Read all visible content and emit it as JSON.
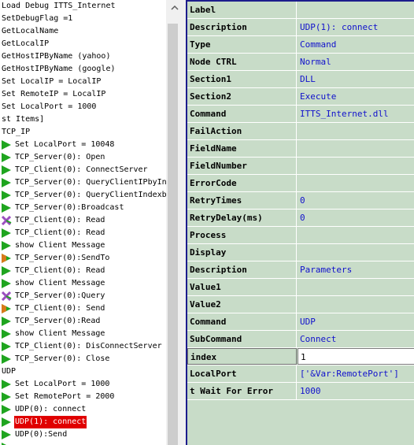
{
  "tree": {
    "items": [
      {
        "text": "Load Debug ITTS_Internet",
        "icon": ""
      },
      {
        "text": "SetDebugFlag =1",
        "icon": ""
      },
      {
        "text": "GetLocalName",
        "icon": ""
      },
      {
        "text": "GetLocalIP",
        "icon": ""
      },
      {
        "text": "GetHostIPByName (yahoo)",
        "icon": ""
      },
      {
        "text": "GetHostIPByName (google)",
        "icon": ""
      },
      {
        "text": "Set LocalIP = LocalIP",
        "icon": ""
      },
      {
        "text": "Set RemoteIP = LocalIP",
        "icon": ""
      },
      {
        "text": "Set LocalPort = 1000",
        "icon": ""
      },
      {
        "text": "st Items]",
        "icon": ""
      },
      {
        "text": "TCP_IP",
        "icon": ""
      },
      {
        "text": "Set LocalPort = 10048",
        "icon": "play"
      },
      {
        "text": "TCP_Server(0): Open",
        "icon": "play"
      },
      {
        "text": "TCP_Client(0): ConnectServer",
        "icon": "play"
      },
      {
        "text": "TCP_Server(0): QueryClientIPbyIn",
        "icon": "play"
      },
      {
        "text": "TCP_Server(0): QueryClientIndexb",
        "icon": "play"
      },
      {
        "text": "TCP_Server(0):Broadcast",
        "icon": "play"
      },
      {
        "text": "TCP_Client(0): Read",
        "icon": "x"
      },
      {
        "text": "TCP_Client(0): Read",
        "icon": "play"
      },
      {
        "text": "show Client Message",
        "icon": "play"
      },
      {
        "text": "TCP_Server(0):SendTo",
        "icon": "playorange"
      },
      {
        "text": "TCP_Client(0): Read",
        "icon": "play"
      },
      {
        "text": "show Client Message",
        "icon": "play"
      },
      {
        "text": "TCP_Server(0):Query",
        "icon": "x"
      },
      {
        "text": "TCP_Client(0): Send",
        "icon": "playorange"
      },
      {
        "text": "TCP_Server(0):Read",
        "icon": "play"
      },
      {
        "text": "show Client Message",
        "icon": "play"
      },
      {
        "text": "TCP_Client(0): DisConnectServer",
        "icon": "play"
      },
      {
        "text": "TCP_Server(0): Close",
        "icon": "play"
      },
      {
        "text": "UDP",
        "icon": ""
      },
      {
        "text": "Set LocalPort = 1000",
        "icon": "play"
      },
      {
        "text": "Set RemotePort = 2000",
        "icon": "play"
      },
      {
        "text": "UDP(0): connect",
        "icon": "play"
      },
      {
        "text": "UDP(1): connect",
        "icon": "play",
        "selected": true
      },
      {
        "text": "UDP(0):Send",
        "icon": "play"
      },
      {
        "text": "",
        "icon": "play"
      }
    ]
  },
  "properties": [
    {
      "name": "Label",
      "value": ""
    },
    {
      "name": "Description",
      "value": "UDP(1): connect"
    },
    {
      "name": "Type",
      "value": "Command"
    },
    {
      "name": "Node CTRL",
      "value": "Normal"
    },
    {
      "name": "Section1",
      "value": "DLL"
    },
    {
      "name": "Section2",
      "value": "Execute"
    },
    {
      "name": "Command",
      "value": "ITTS_Internet.dll"
    },
    {
      "name": "FailAction",
      "value": ""
    },
    {
      "name": "FieldName",
      "value": ""
    },
    {
      "name": "FieldNumber",
      "value": ""
    },
    {
      "name": "ErrorCode",
      "value": ""
    },
    {
      "name": "RetryTimes",
      "value": "0"
    },
    {
      "name": "RetryDelay(ms)",
      "value": "0"
    },
    {
      "name": "Process",
      "value": ""
    },
    {
      "name": "Display",
      "value": ""
    },
    {
      "name": "Description",
      "value": "Parameters"
    },
    {
      "name": "Value1",
      "value": ""
    },
    {
      "name": "Value2",
      "value": ""
    },
    {
      "name": "Command",
      "value": "UDP"
    },
    {
      "name": "SubCommand",
      "value": "Connect"
    },
    {
      "name": "index",
      "value": "1",
      "editing": true
    },
    {
      "name": "LocalPort",
      "value": "['&Var:RemotePort']"
    },
    {
      "name": "t Wait For Error",
      "value": "1000"
    }
  ],
  "colors": {
    "grid_bg": "#c8dcc8",
    "value_text": "#1010cc",
    "selection": "#e00000",
    "play_green": "#1fa51f",
    "x_purple": "#9a4fbf"
  }
}
